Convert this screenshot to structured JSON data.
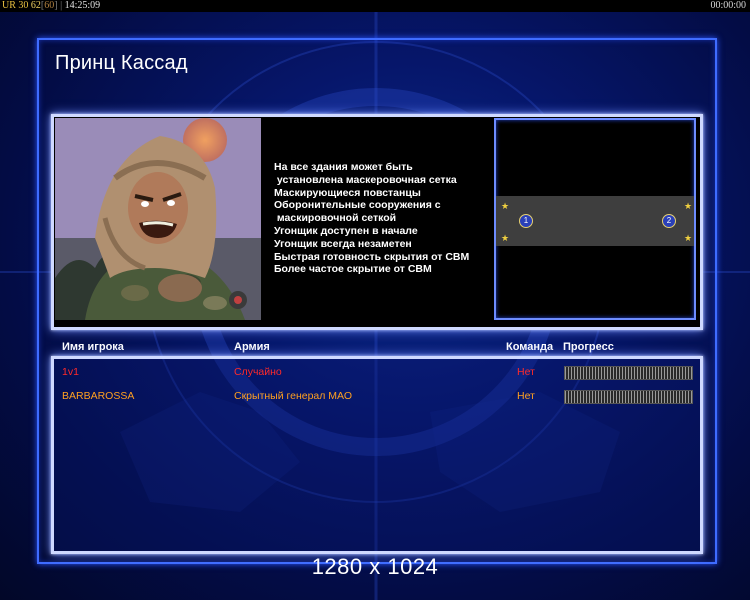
{
  "topbar": {
    "ur": "UR",
    "a": "30",
    "b": "62",
    "c": "60",
    "time": "14:25:09",
    "timer_right": "00:00:00"
  },
  "title": "Принц Кассад",
  "faction_features": [
    "На все здания может быть",
    " установлена маскеровочная сетка",
    "Маскирующиеся повстанцы",
    "Оборонительные сооружения с",
    " маскировочной сеткой",
    "Угонщик доступен в начале",
    "Угонщик всегда незаметен",
    "Быстрая готовность скрытия от СВМ",
    "Более частое скрытие от СВМ"
  ],
  "minimap": {
    "start_positions": [
      "1",
      "2"
    ]
  },
  "columns": {
    "player": "Имя игрока",
    "army": "Армия",
    "team": "Команда",
    "progress": "Прогресс"
  },
  "players": [
    {
      "name": "1v1",
      "army": "Случайно",
      "team": "Нет",
      "color": "#ff2a2a",
      "progress": 0.0
    },
    {
      "name": "BARBAROSSA",
      "army": "Скрытный генерал МАО",
      "team": "Нет",
      "color": "#ffa020",
      "progress": 0.0
    }
  ],
  "resolution": "1280 x 1024",
  "colors": {
    "frame": "#3f6cff",
    "panel_border": "#cfd9ff",
    "background": "#06166a"
  }
}
